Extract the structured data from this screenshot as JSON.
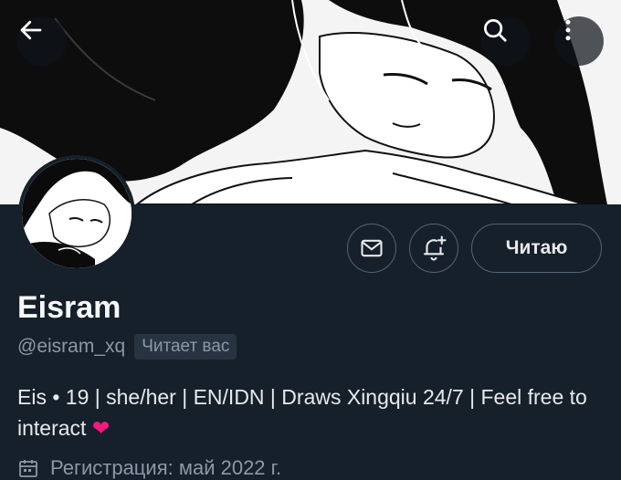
{
  "header": {
    "back_icon": "arrow-left-icon",
    "search_icon": "search-icon",
    "more_icon": "more-vertical-icon"
  },
  "profile": {
    "display_name": "Eisram",
    "handle": "@eisram_xq",
    "follows_you": "Читает вас",
    "bio_text": "Eis • 19 | she/her | EN/IDN | Draws Xingqiu 24/7 | Feel free to interact",
    "bio_emoji": "❤",
    "joined": "Регистрация: май 2022 г."
  },
  "actions": {
    "message_icon": "envelope-icon",
    "notify_icon": "bell-plus-icon",
    "follow_label": "Читаю"
  },
  "colors": {
    "background": "#15202b",
    "secondary_text": "#8b98a5",
    "border": "#536471",
    "heart": "#f91880"
  }
}
